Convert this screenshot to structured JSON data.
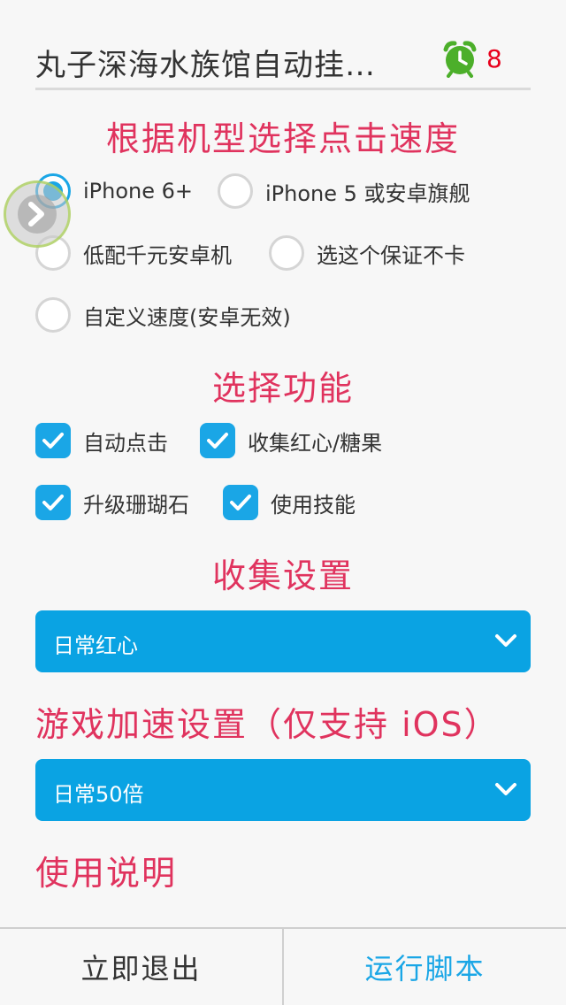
{
  "header": {
    "title": "丸子深海水族馆自动挂…",
    "alarm_count": "8",
    "alarm_icon": "alarm-clock-icon",
    "alarm_color": "#4caf2a",
    "count_color": "#e8001c"
  },
  "sections": {
    "speed_title": "根据机型选择点击速度",
    "feature_title": "选择功能",
    "collect_title": "收集设置",
    "accel_title": "游戏加速设置（仅支持 iOS）",
    "help_title": "使用说明"
  },
  "speed_options": [
    {
      "label": "iPhone 6+",
      "selected": true
    },
    {
      "label": "iPhone 5 或安卓旗舰",
      "selected": false
    },
    {
      "label": "低配千元安卓机",
      "selected": false
    },
    {
      "label": "选这个保证不卡",
      "selected": false
    },
    {
      "label": "自定义速度(安卓无效)",
      "selected": false
    }
  ],
  "features": [
    {
      "label": "自动点击",
      "checked": true
    },
    {
      "label": "收集红心/糖果",
      "checked": true
    },
    {
      "label": "升级珊瑚石",
      "checked": true
    },
    {
      "label": "使用技能",
      "checked": true
    }
  ],
  "collect_select": {
    "value": "日常红心"
  },
  "accel_select": {
    "value": "日常50倍"
  },
  "footer": {
    "exit_label": "立即退出",
    "run_label": "运行脚本"
  },
  "colors": {
    "accent": "#1aa6e6",
    "section_title": "#e0335e",
    "dropdown_bg": "#0aa3e3"
  }
}
